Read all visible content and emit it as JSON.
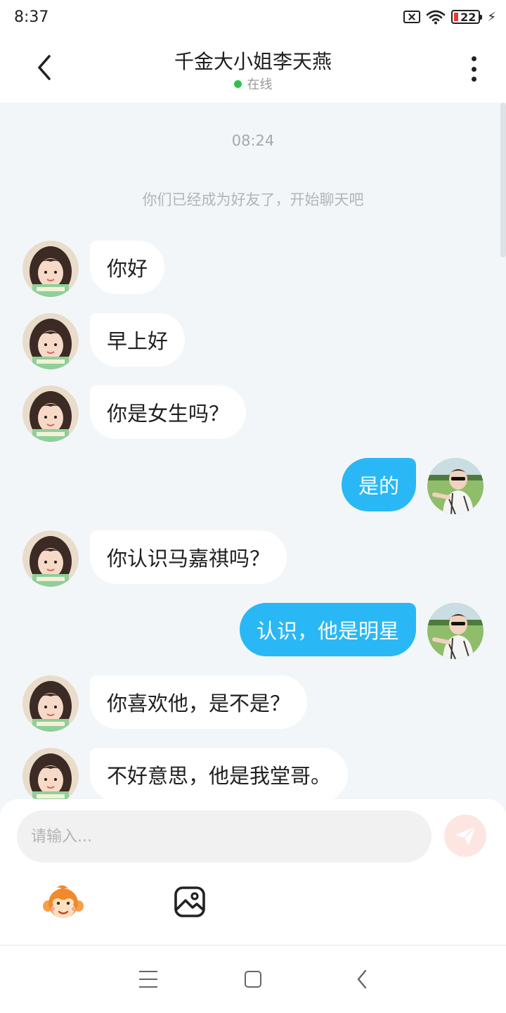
{
  "status_bar": {
    "time": "8:37",
    "battery": "22"
  },
  "header": {
    "title": "千金大小姐李天燕",
    "status": "在线",
    "status_color": "#2dc24d"
  },
  "chat": {
    "timestamp": "08:24",
    "system_message": "你们已经成为好友了，开始聊天吧",
    "messages": [
      {
        "direction": "in",
        "text": "你好"
      },
      {
        "direction": "in",
        "text": "早上好"
      },
      {
        "direction": "in",
        "text": "你是女生吗？"
      },
      {
        "direction": "out",
        "text": "是的"
      },
      {
        "direction": "in",
        "text": "你认识马嘉祺吗？"
      },
      {
        "direction": "out",
        "text": "认识，他是明星"
      },
      {
        "direction": "in",
        "text": "你喜欢他，是不是？"
      },
      {
        "direction": "in",
        "text": "不好意思，他是我堂哥。"
      }
    ],
    "outgoing_bubble_color": "#29b8f5"
  },
  "composer": {
    "placeholder": "请输入...",
    "value": ""
  },
  "toolbar": {
    "icons": [
      "monkey-emoji-icon",
      "image-icon"
    ]
  },
  "navigation": {
    "icons": [
      "menu-icon",
      "home-icon",
      "back-icon"
    ]
  }
}
